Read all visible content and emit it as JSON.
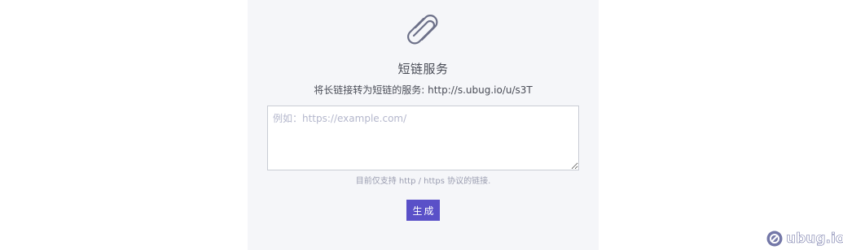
{
  "header": {
    "logo_icon": "link-icon",
    "title": "短链服务",
    "subtitle": "将长链接转为短链的服务: http://s.ubug.io/u/s3T"
  },
  "form": {
    "url_input": {
      "value": "",
      "placeholder": "例如：https://example.com/"
    },
    "hint": "目前仅支持 http / https 协议的链接.",
    "generate_label": "生成"
  },
  "watermark": {
    "icon": "ubug-logo-icon",
    "text": "ubug.io"
  },
  "colors": {
    "panel_background": "#f5f6f9",
    "accent": "#5a50c8",
    "text": "#4a4d57"
  }
}
